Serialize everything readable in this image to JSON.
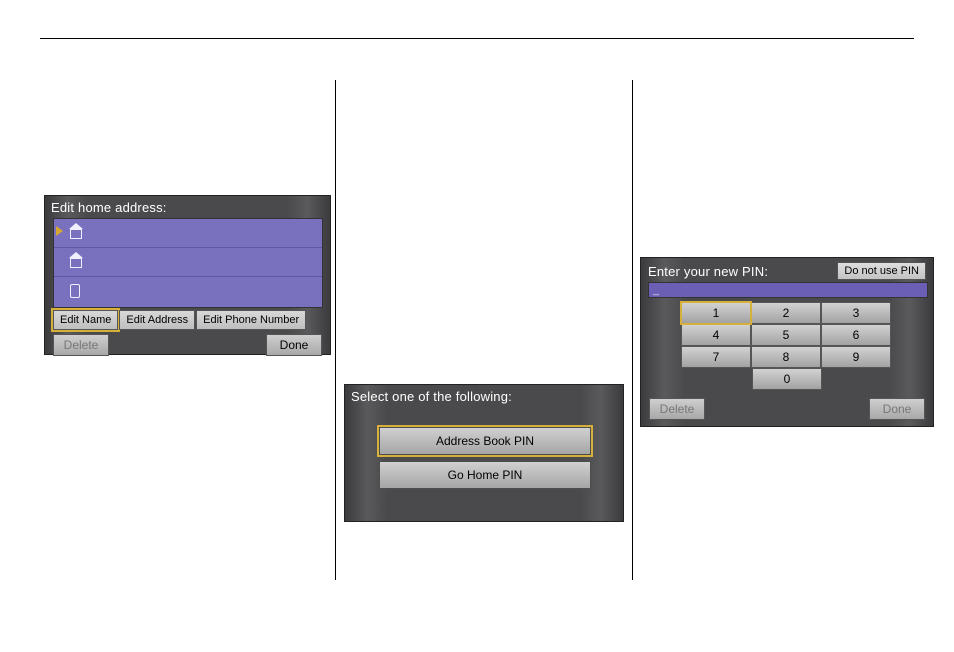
{
  "panel_home": {
    "title": "Edit home address:",
    "tabs": {
      "edit_name": "Edit Name",
      "edit_address": "Edit Address",
      "edit_phone": "Edit Phone Number"
    },
    "delete_label": "Delete",
    "done_label": "Done"
  },
  "panel_select": {
    "title": "Select one of the following:",
    "option_address_book": "Address Book PIN",
    "option_go_home": "Go Home PIN"
  },
  "panel_pin": {
    "title": "Enter your new PIN:",
    "do_not_use_label": "Do not use PIN",
    "field_value": "_",
    "keys": {
      "k1": "1",
      "k2": "2",
      "k3": "3",
      "k4": "4",
      "k5": "5",
      "k6": "6",
      "k7": "7",
      "k8": "8",
      "k9": "9",
      "k0": "0"
    },
    "delete_label": "Delete",
    "done_label": "Done"
  }
}
